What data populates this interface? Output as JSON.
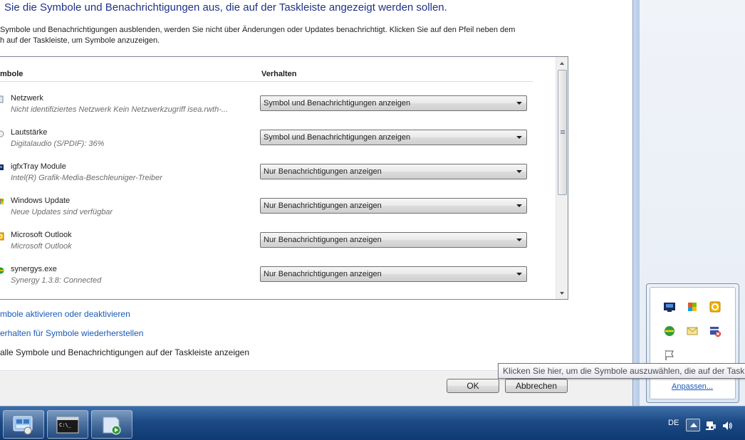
{
  "dialog": {
    "heading": "Sie die Symbole und Benachrichtigungen aus, die auf der Taskleiste angezeigt werden sollen.",
    "description_line1": "Symbole und Benachrichtigungen ausblenden, werden Sie nicht über Änderungen oder Updates benachrichtigt. Klicken Sie auf den Pfeil neben dem",
    "description_line2": "h auf der Taskleiste, um Symbole anzuzeigen.",
    "col_icons": "mbole",
    "col_behavior": "Verhalten",
    "rows": [
      {
        "name": "Netzwerk",
        "sub": "Nicht identifiziertes Netzwerk Kein Netzwerkzugriff isea.rwth-...",
        "behavior": "Symbol und Benachrichtigungen anzeigen",
        "icon": "network-icon"
      },
      {
        "name": "Lautstärke",
        "sub": "Digitalaudio (S/PDIF): 36%",
        "behavior": "Symbol und Benachrichtigungen anzeigen",
        "icon": "speaker-icon"
      },
      {
        "name": "igfxTray Module",
        "sub": "Intel(R) Grafik-Media-Beschleuniger-Treiber",
        "behavior": "Nur Benachrichtigungen anzeigen",
        "icon": "monitor-icon"
      },
      {
        "name": "Windows Update",
        "sub": "Neue Updates sind verfügbar",
        "behavior": "Nur Benachrichtigungen anzeigen",
        "icon": "windows-update-icon"
      },
      {
        "name": "Microsoft Outlook",
        "sub": "Microsoft Outlook",
        "behavior": "Nur Benachrichtigungen anzeigen",
        "icon": "outlook-icon"
      },
      {
        "name": "synergys.exe",
        "sub": "Synergy 1.3.8:  Connected",
        "behavior": "Nur Benachrichtigungen anzeigen",
        "icon": "synergy-icon"
      }
    ],
    "link_toggle_system_icons": "mbole aktivieren oder deaktivieren",
    "link_restore_defaults": "erhalten für Symbole wiederherstellen",
    "checkbox_label": "alle Symbole und Benachrichtigungen auf der Taskleiste anzeigen",
    "ok_label": "OK",
    "cancel_label": "Abbrechen"
  },
  "tray_popup": {
    "customize_link": "Anpassen...",
    "icons": [
      "monitor-icon",
      "windows-update-icon",
      "outlook-icon",
      "synergy-icon",
      "mail-icon",
      "security-icon",
      "flag-icon"
    ]
  },
  "tooltip": {
    "text": "Klicken Sie hier, um die Symbole auszuwählen, die auf der Taskleiste"
  },
  "taskbar": {
    "language": "DE",
    "buttons": [
      "control-panel-icon",
      "console-icon",
      "media-player-icon"
    ]
  },
  "colors": {
    "heading": "#1e3287",
    "link": "#1a5ab8",
    "taskbar": "#1c4a85"
  }
}
